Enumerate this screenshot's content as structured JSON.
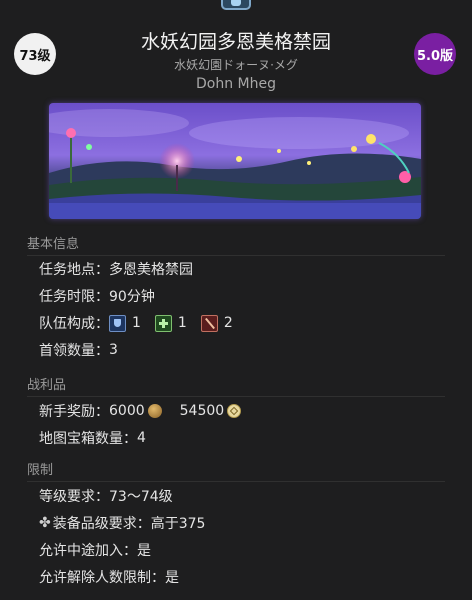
{
  "header": {
    "level_badge": "73级",
    "version_badge": "5.0版",
    "title": "水妖幻园多恩美格禁园",
    "subtitle_jp": "水妖幻園ドォーヌ·メグ",
    "subtitle_en": "Dohn Mheg",
    "top_icon": "duty-icon",
    "colors": {
      "level_badge_bg": "#f1f1f1",
      "version_badge_bg": "#7a1fa2"
    }
  },
  "banner": {
    "icon": "dungeon-landscape-image"
  },
  "basic_info": {
    "header": "基本信息",
    "location_label": "任务地点：",
    "location_value": "多恩美格禁园",
    "time_label": "任务时限：",
    "time_value": "90分钟",
    "party_label": "队伍构成：",
    "party": [
      {
        "role": "tank",
        "icon": "tank-role-icon",
        "count": "1"
      },
      {
        "role": "healer",
        "icon": "healer-role-icon",
        "count": "1"
      },
      {
        "role": "dps",
        "icon": "dps-role-icon",
        "count": "2"
      }
    ],
    "boss_label": "首领数量：",
    "boss_value": "3"
  },
  "loot": {
    "header": "战利品",
    "novice_label": "新手奖励：",
    "gil_value": "6000",
    "gil_icon": "gil-coin-icon",
    "mgp_value": "54500",
    "mgp_icon": "mgp-icon",
    "treasure_label": "地图宝箱数量：",
    "treasure_value": "4"
  },
  "limits": {
    "header": "限制",
    "level_label": "等级要求：",
    "level_value": "73～74级",
    "ilvl_icon": "item-level-icon",
    "ilvl_label": "装备品级要求：",
    "ilvl_value": "高于375",
    "join_label": "允许中途加入：",
    "join_value": "是",
    "unrestricted_label": "允许解除人数限制：",
    "unrestricted_value": "是"
  }
}
